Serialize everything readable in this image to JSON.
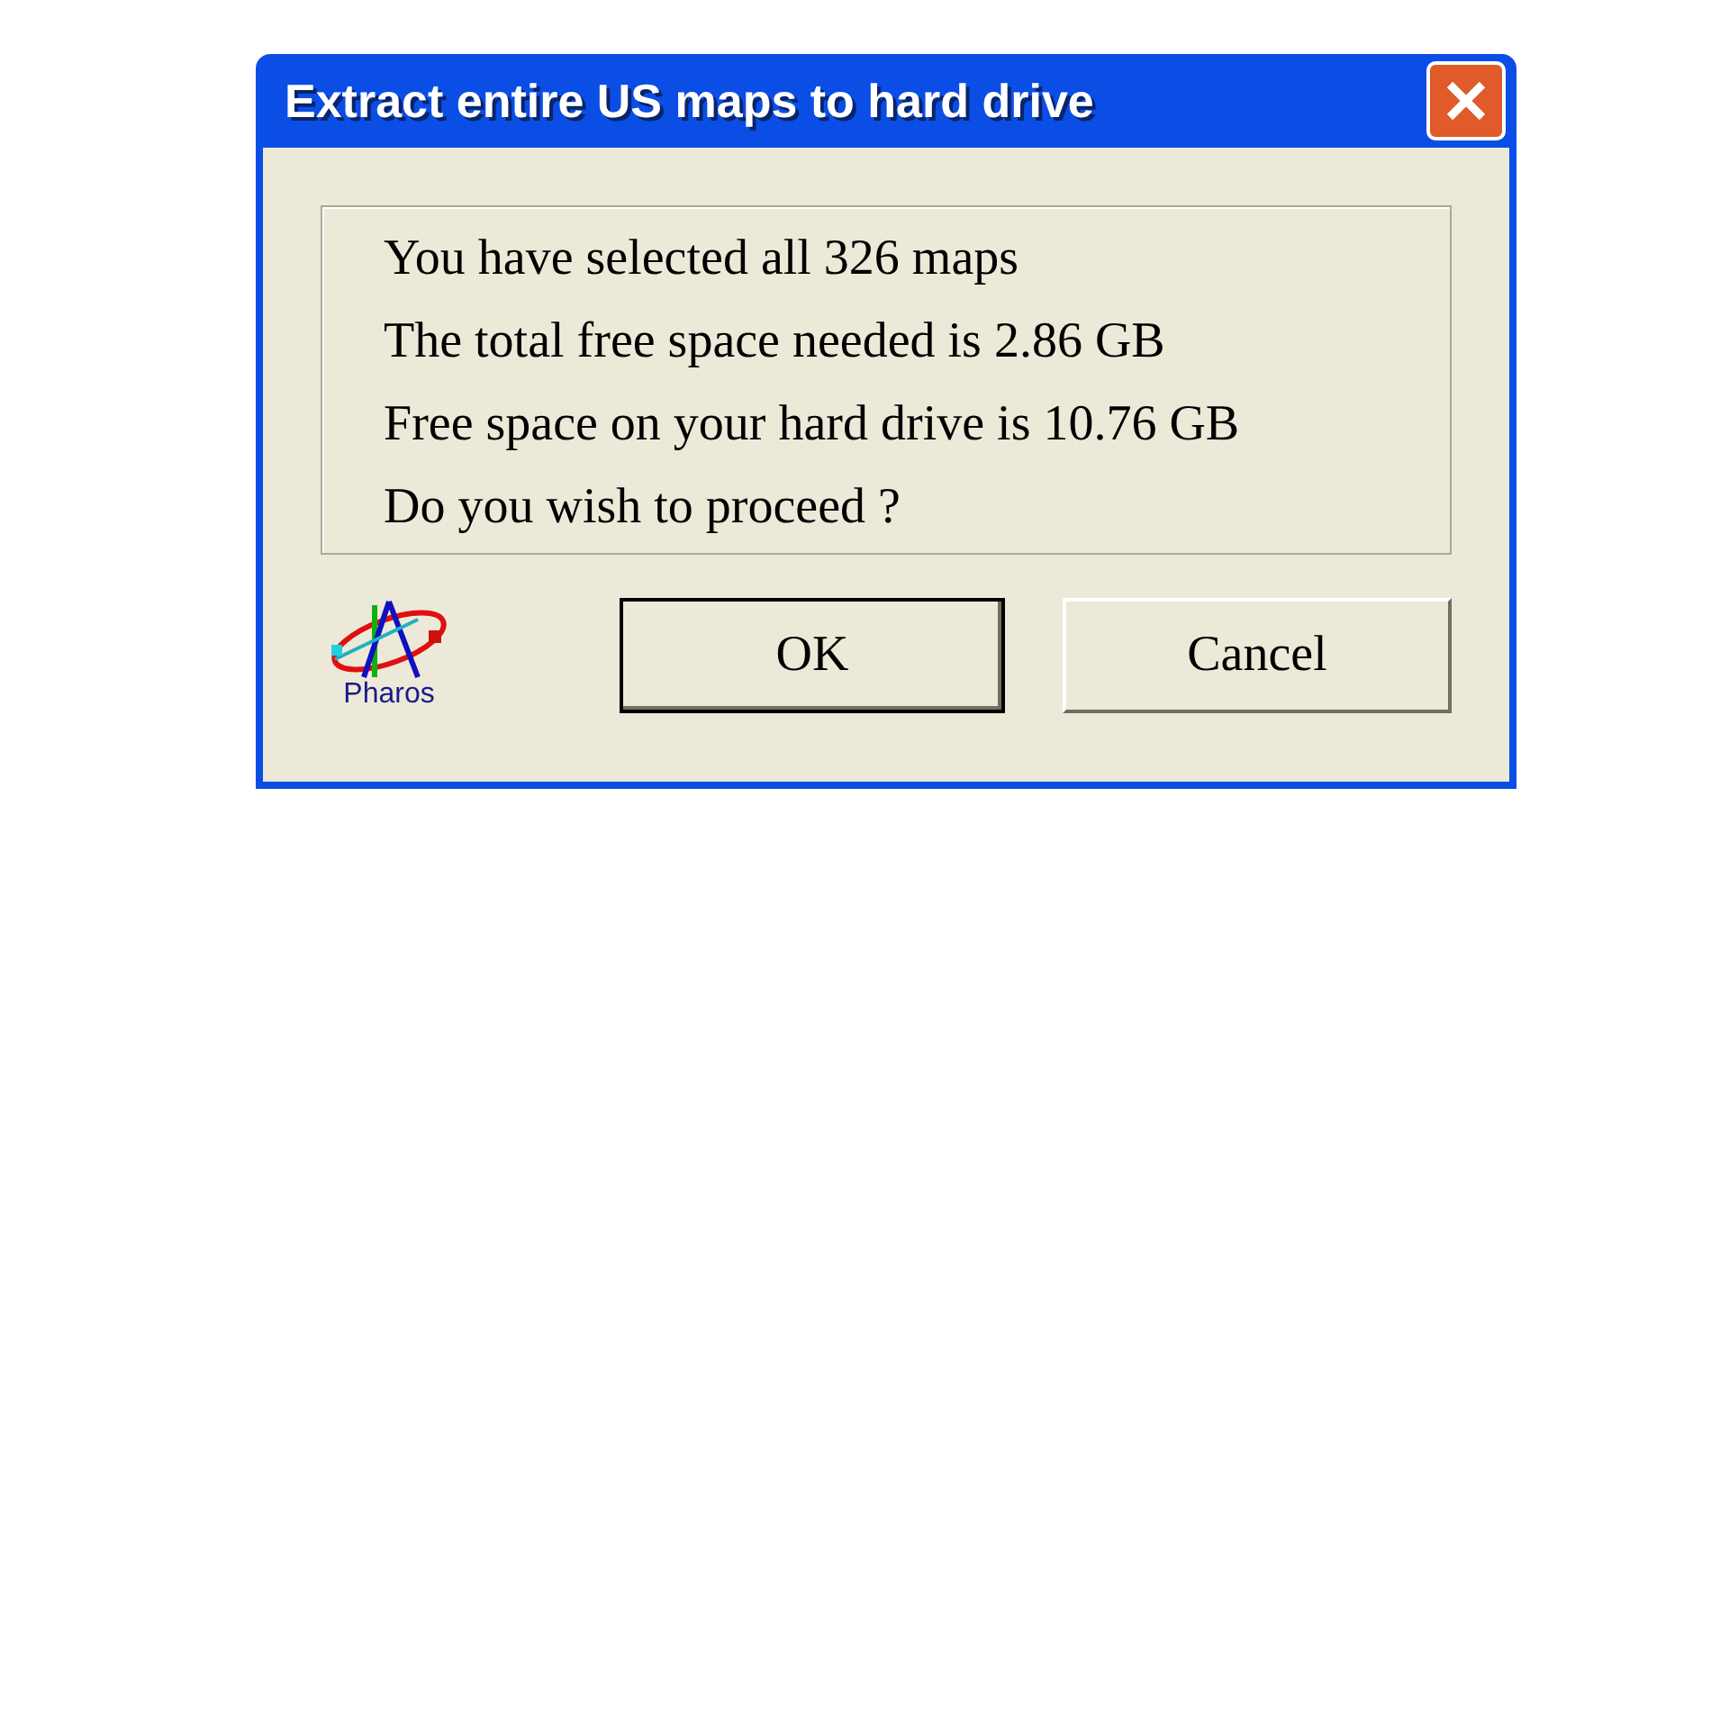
{
  "window": {
    "title": "Extract entire US maps to hard drive"
  },
  "message_lines": [
    "You have selected all 326 maps",
    "The total free space needed is 2.86 GB",
    "Free space on your hard drive is 10.76 GB",
    "Do you wish to proceed ?"
  ],
  "logo": {
    "text": "Pharos"
  },
  "buttons": [
    {
      "label": "OK",
      "default": true
    },
    {
      "label": "Cancel",
      "default": false
    }
  ]
}
